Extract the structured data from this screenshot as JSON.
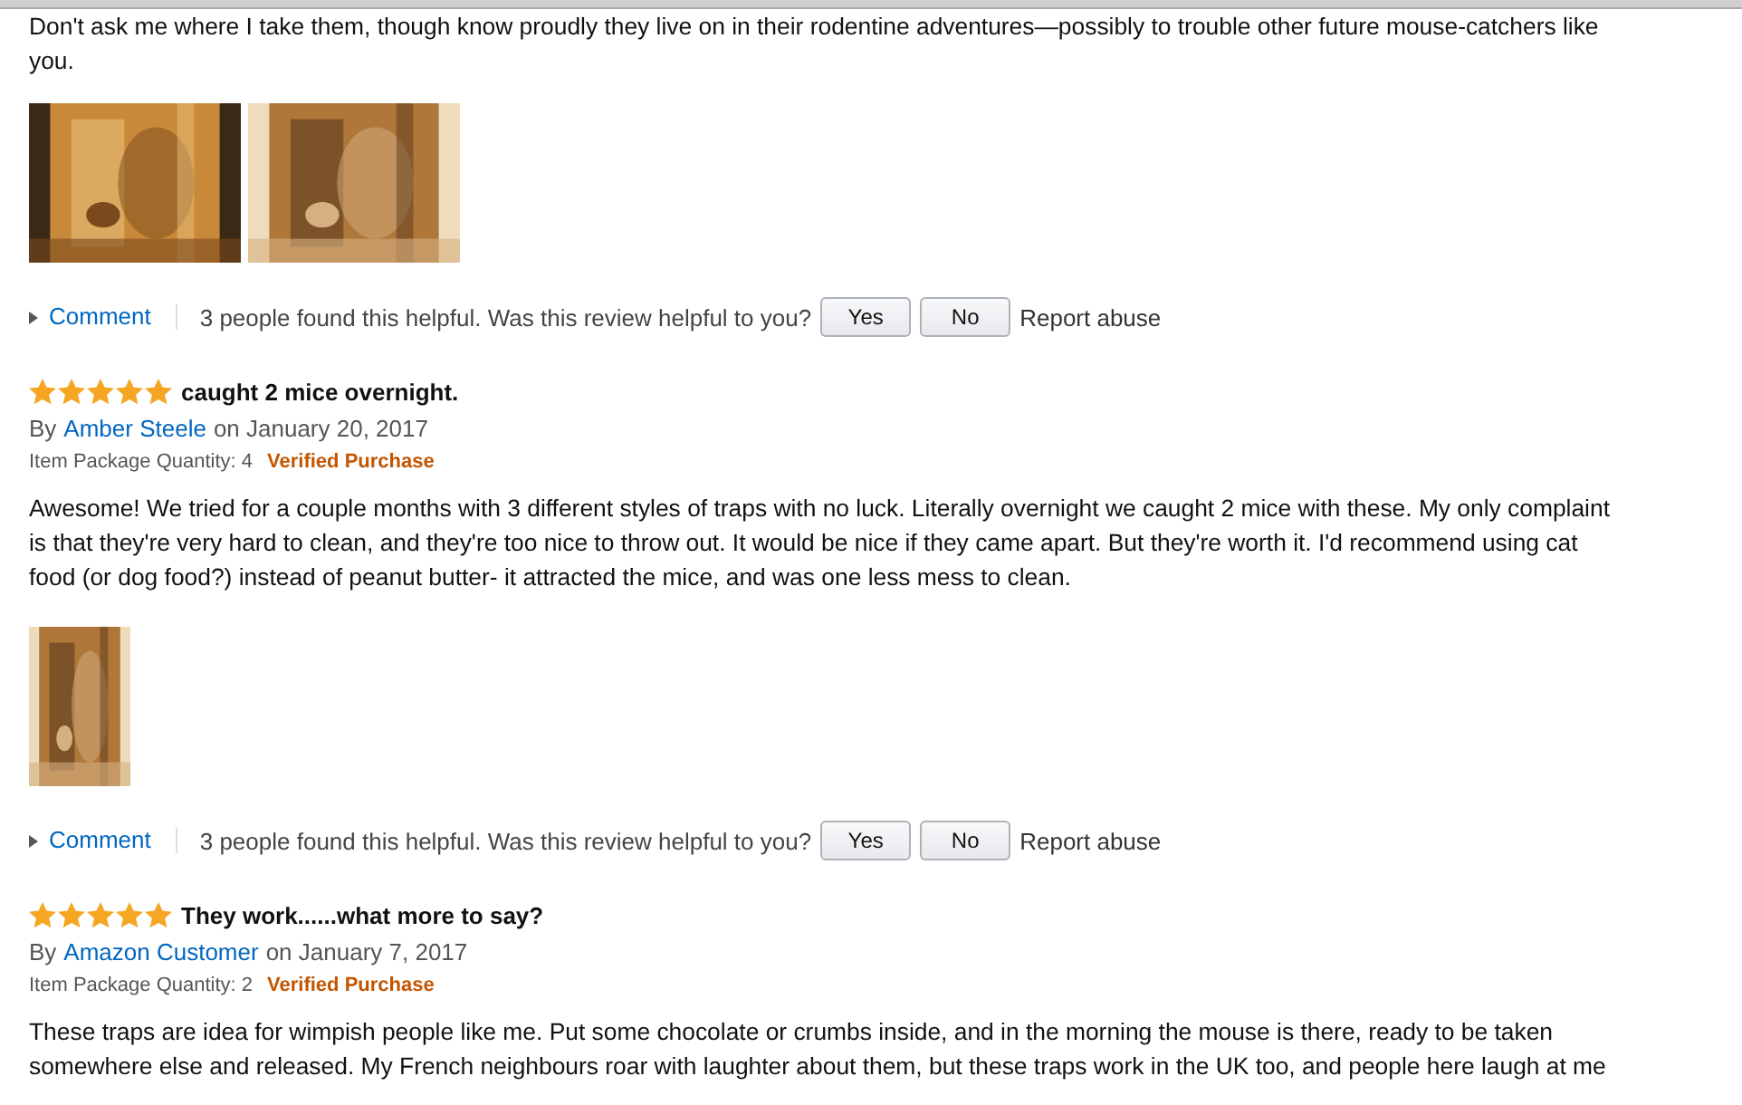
{
  "reviews": [
    {
      "body": "Don't ask me where I take them, though know proudly they live on in their rodentine adventures—possibly to trouble other future mouse-catchers like you.",
      "images": [
        {
          "kind": "picture"
        },
        {
          "kind": "picture"
        }
      ],
      "footer": {
        "comment": "Comment",
        "helpful": "3 people found this helpful. Was this review helpful to you?",
        "yes": "Yes",
        "no": "No",
        "report": "Report abuse"
      }
    },
    {
      "stars": 5,
      "title": "caught 2 mice overnight.",
      "by": "By",
      "author": "Amber Steele",
      "date": "on January 20, 2017",
      "quantity": "Item Package Quantity: 4",
      "verified": "Verified Purchase",
      "body": "Awesome! We tried for a couple months with 3 different styles of traps with no luck. Literally overnight we caught 2 mice with these. My only complaint is that they're very hard to clean, and they're too nice to throw out. It would be nice if they came apart. But they're worth it. I'd recommend using cat food (or dog food?) instead of peanut butter- it attracted the mice, and was one less mess to clean.",
      "images": [
        {
          "kind": "picture"
        }
      ],
      "footer": {
        "comment": "Comment",
        "helpful": "3 people found this helpful. Was this review helpful to you?",
        "yes": "Yes",
        "no": "No",
        "report": "Report abuse"
      }
    },
    {
      "stars": 5,
      "title": "They work......what more to say?",
      "by": "By",
      "author": "Amazon Customer",
      "date": "on January 7, 2017",
      "quantity": "Item Package Quantity: 2",
      "verified": "Verified Purchase",
      "body": "These traps are idea for wimpish people like me. Put some chocolate or crumbs inside, and in the morning the mouse is there, ready to be taken somewhere else and released. My French neighbours roar with laughter about them, but these traps work in the UK too, and people here laugh at me"
    }
  ]
}
